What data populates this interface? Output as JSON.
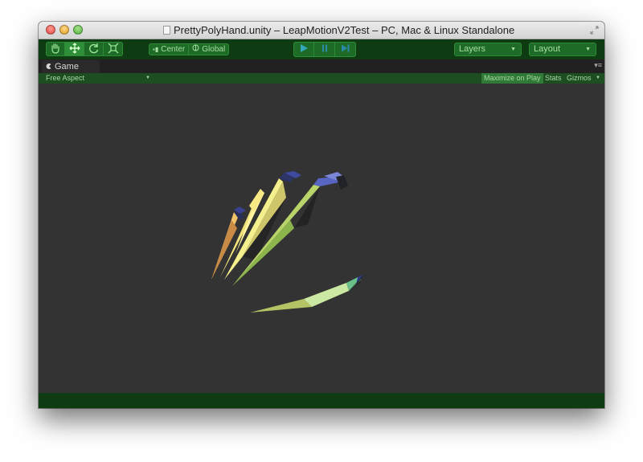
{
  "window": {
    "title": "PrettyPolyHand.unity – LeapMotionV2Test – PC, Mac & Linux Standalone"
  },
  "toolbar": {
    "tools": [
      {
        "name": "hand-tool",
        "icon": "hand-icon"
      },
      {
        "name": "move-tool",
        "icon": "move-icon"
      },
      {
        "name": "rotate-tool",
        "icon": "rotate-icon"
      },
      {
        "name": "scale-tool",
        "icon": "scale-icon"
      }
    ],
    "pivot_label": "Center",
    "space_label": "Global",
    "layers_label": "Layers",
    "layout_label": "Layout"
  },
  "game_tab": {
    "label": "Game"
  },
  "game_bar": {
    "aspect": "Free Aspect",
    "maximize_on_play": "Maximize on Play",
    "stats": "Stats",
    "gizmos": "Gizmos"
  },
  "colors": {
    "chrome_green": "#0e3b12",
    "button_green": "#1d6b26",
    "viewport_bg": "#333333",
    "play_accent": "#34a7b8"
  }
}
